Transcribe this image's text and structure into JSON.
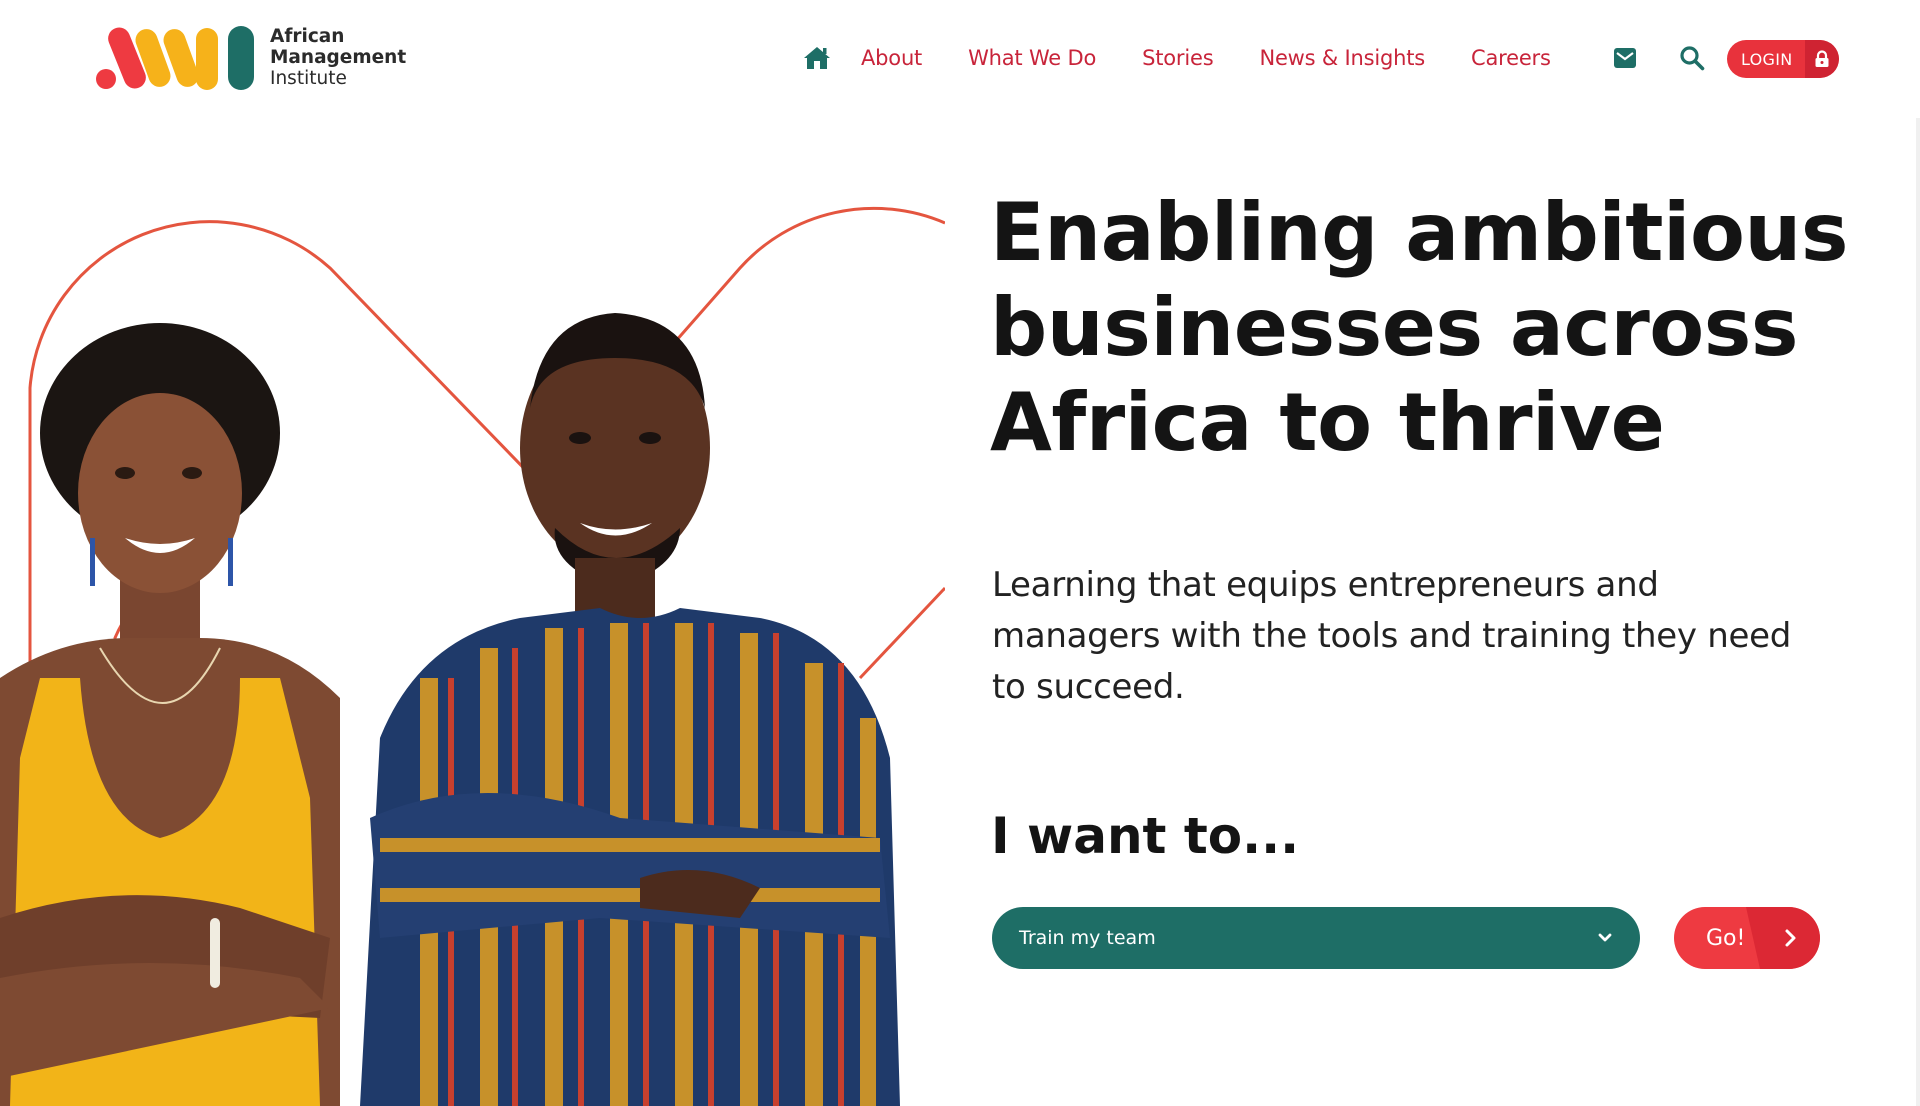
{
  "brand": {
    "name_line1": "African",
    "name_line2": "Management",
    "name_line3": "Institute",
    "colors": {
      "red": "#ee3a41",
      "yellow": "#f6b21a",
      "teal": "#1e6e66",
      "nav_text": "#c8243a"
    }
  },
  "nav": {
    "home_icon": "home-icon",
    "items": [
      {
        "label": "About"
      },
      {
        "label": "What We Do"
      },
      {
        "label": "Stories"
      },
      {
        "label": "News & Insights"
      },
      {
        "label": "Careers"
      }
    ],
    "mail_icon": "mail-icon",
    "search_icon": "search-icon",
    "login_label": "LOGIN",
    "login_icon": "lock-icon"
  },
  "hero": {
    "title_line1": "Enabling ambitious",
    "title_line2": "businesses across",
    "title_line3": "Africa to thrive",
    "subtitle": "Learning that equips entrepreneurs and managers with the tools and training they need to succeed.",
    "image_alt": "Two smiling people with arms crossed"
  },
  "cta": {
    "prompt": "I want to...",
    "selected_option": "Train my team",
    "go_label": "Go!",
    "go_icon": "chevron-right-icon"
  }
}
